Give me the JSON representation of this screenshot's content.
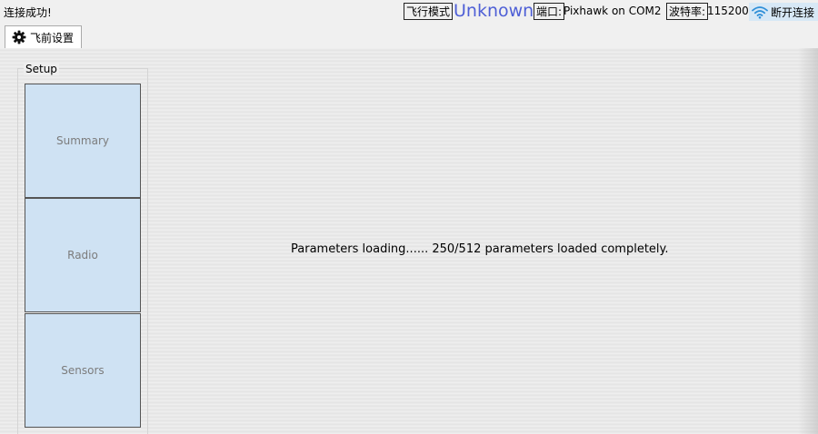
{
  "header": {
    "connection_status": "连接成功!",
    "flight_mode_label": "飞行模式",
    "flight_mode_value": "Unknown",
    "port_label": "端口:",
    "port_value": "Pixhawk on COM2",
    "baud_label": "波特率:",
    "baud_value": "115200",
    "disconnect_label": "断开连接",
    "disconnect_icon": "wifi-icon"
  },
  "tabs": [
    {
      "label": "飞前设置",
      "icon": "gear-icon"
    }
  ],
  "setup": {
    "title": "Setup",
    "buttons": [
      {
        "label": "Summary"
      },
      {
        "label": "Radio"
      },
      {
        "label": "Sensors"
      }
    ]
  },
  "main": {
    "status_message": "Parameters loading...... 250/512 parameters loaded completely."
  },
  "colors": {
    "mode_value": "#4e5fd6",
    "setup_button_bg": "#cfe2f3",
    "disconnect_bg": "#d7e8f6",
    "wifi_icon": "#2f8fd8"
  }
}
